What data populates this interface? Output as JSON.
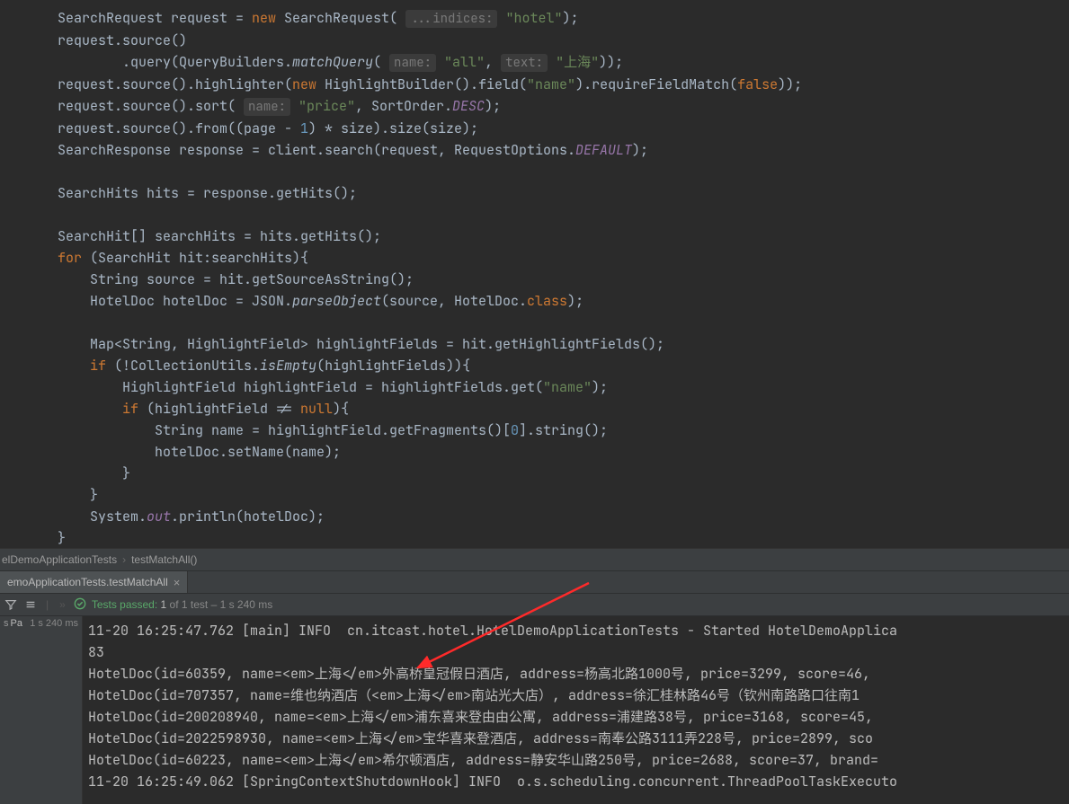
{
  "code": {
    "l1a": "SearchRequest request = ",
    "l1_new": "new",
    "l1b": " SearchRequest( ",
    "l1_hint": "...indices:",
    "l1_str": " \"hotel\"",
    "l1c": ");",
    "l2": "request.source()",
    "l3a": "        .query(QueryBuilders.",
    "l3_m": "matchQuery",
    "l3b": "( ",
    "l3_hint1": "name:",
    "l3_str1": " \"all\"",
    "l3c": ", ",
    "l3_hint2": "text:",
    "l3_str2": " \"上海\"",
    "l3d": "));",
    "l4a": "request.source().highlighter(",
    "l4_new": "new",
    "l4b": " HighlightBuilder().field(",
    "l4_str": "\"name\"",
    "l4c": ").requireFieldMatch(",
    "l4_false": "false",
    "l4d": "));",
    "l5a": "request.source().sort( ",
    "l5_hint": "name:",
    "l5_str": " \"price\"",
    "l5b": ", SortOrder.",
    "l5_desc": "DESC",
    "l5c": ");",
    "l6a": "request.source().from((page - ",
    "l6_n1": "1",
    "l6b": ") * size).size(size);",
    "l7a": "SearchResponse response = client.search(request, RequestOptions.",
    "l7_def": "DEFAULT",
    "l7b": ");",
    "l9": "SearchHits hits = response.getHits();",
    "l11": "SearchHit[] searchHits = hits.getHits();",
    "l12a": "for",
    "l12b": " (SearchHit hit:searchHits){",
    "l13": "    String source = hit.getSourceAsString();",
    "l14a": "    HotelDoc hotelDoc = JSON.",
    "l14_m": "parseObject",
    "l14b": "(source, HotelDoc.",
    "l14_cls": "class",
    "l14c": ");",
    "l16": "    Map<String, HighlightField> highlightFields = hit.getHighlightFields();",
    "l17a": "    ",
    "l17_if": "if",
    "l17b": " (!CollectionUtils.",
    "l17_m": "isEmpty",
    "l17c": "(highlightFields)){",
    "l18a": "        HighlightField highlightField = highlightFields.get(",
    "l18_str": "\"name\"",
    "l18b": ");",
    "l19a": "        ",
    "l19_if": "if",
    "l19b": " (highlightField != ",
    "l19_null": "null",
    "l19c": "){",
    "l20a": "            String name = highlightField.getFragments()[",
    "l20_n": "0",
    "l20b": "].string();",
    "l21": "            hotelDoc.setName(name);",
    "l22": "        }",
    "l23": "    }",
    "l24a": "    System.",
    "l24_out": "out",
    "l24b": ".println(hotelDoc);",
    "l25": "}"
  },
  "breadcrumb": {
    "cls": "elDemoApplicationTests",
    "method": "testMatchAll()"
  },
  "tab": {
    "label": "emoApplicationTests.testMatchAll"
  },
  "toolbar": {
    "tests_passed_prefix": "Tests passed:",
    "tests_count": " 1",
    "tests_total": " of 1 test",
    "tests_time": " – 1 s 240 ms"
  },
  "tree": {
    "line1a": "s",
    "line1b": "Pa",
    "line1c": "1 s 240 ms"
  },
  "console": {
    "l1": "11-20 16:25:47.762 [main] INFO  cn.itcast.hotel.HotelDemoApplicationTests - Started HotelDemoApplica",
    "l2": "83",
    "l3": "HotelDoc(id=60359, name=<em>上海</em>外高桥皇冠假日酒店, address=杨高北路1000号, price=3299, score=46, ",
    "l4": "HotelDoc(id=707357, name=维也纳酒店（<em>上海</em>南站光大店）, address=徐汇桂林路46号（钦州南路路口往南1",
    "l5": "HotelDoc(id=200208940, name=<em>上海</em>浦东喜来登由由公寓, address=浦建路38号, price=3168, score=45,",
    "l6": "HotelDoc(id=2022598930, name=<em>上海</em>宝华喜来登酒店, address=南奉公路3111弄228号, price=2899, sco",
    "l7": "HotelDoc(id=60223, name=<em>上海</em>希尔顿酒店, address=静安华山路250号, price=2688, score=37, brand=",
    "l8": "11-20 16:25:49.062 [SpringContextShutdownHook] INFO  o.s.scheduling.concurrent.ThreadPoolTaskExecuto"
  }
}
